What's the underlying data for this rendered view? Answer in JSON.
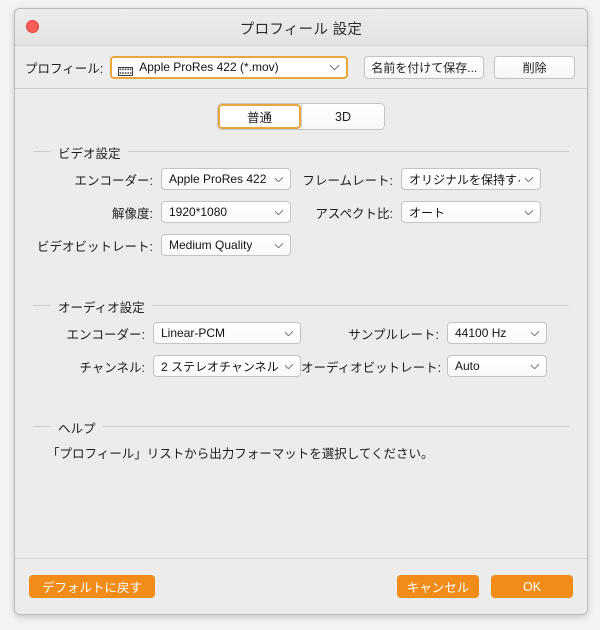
{
  "window": {
    "title": "プロフィール 設定",
    "close_button": "close"
  },
  "profile_bar": {
    "label": "プロフィール:",
    "icon": "film-strip-icon",
    "value": "Apple ProRes 422 (*.mov)",
    "save_as_label": "名前を付けて保存...",
    "delete_label": "削除"
  },
  "tabs": [
    {
      "label": "普通",
      "selected": true
    },
    {
      "label": "3D",
      "selected": false
    }
  ],
  "video_group": {
    "title": "ビデオ設定",
    "rows": [
      {
        "left_label": "エンコーダー:",
        "left_value": "Apple ProRes 422",
        "right_label": "フレームレート:",
        "right_value": "オリジナルを保持する"
      },
      {
        "left_label": "解像度:",
        "left_value": "1920*1080",
        "right_label": "アスペクト比:",
        "right_value": "オート"
      },
      {
        "left_label": "ビデオビットレート:",
        "left_value": "Medium Quality",
        "right_label": "",
        "right_value": ""
      }
    ]
  },
  "audio_group": {
    "title": "オーディオ設定",
    "rows": [
      {
        "left_label": "エンコーダー:",
        "left_value": "Linear-PCM",
        "right_label": "サンプルレート:",
        "right_value": "44100 Hz"
      },
      {
        "left_label": "チャンネル:",
        "left_value": "2 ステレオチャンネル",
        "right_label": "オーディオビットレート:",
        "right_value": "Auto"
      }
    ]
  },
  "help_group": {
    "title": "ヘルプ",
    "text": "「プロフィール」リストから出力フォーマットを選択してください。"
  },
  "footer": {
    "reset_label": "デフォルトに戻す",
    "cancel_label": "キャンセル",
    "ok_label": "OK"
  },
  "colors": {
    "accent_orange": "#f28c18",
    "focus_border": "#e9a63a",
    "window_bg": "#ececec",
    "close_red": "#fc5d55"
  }
}
